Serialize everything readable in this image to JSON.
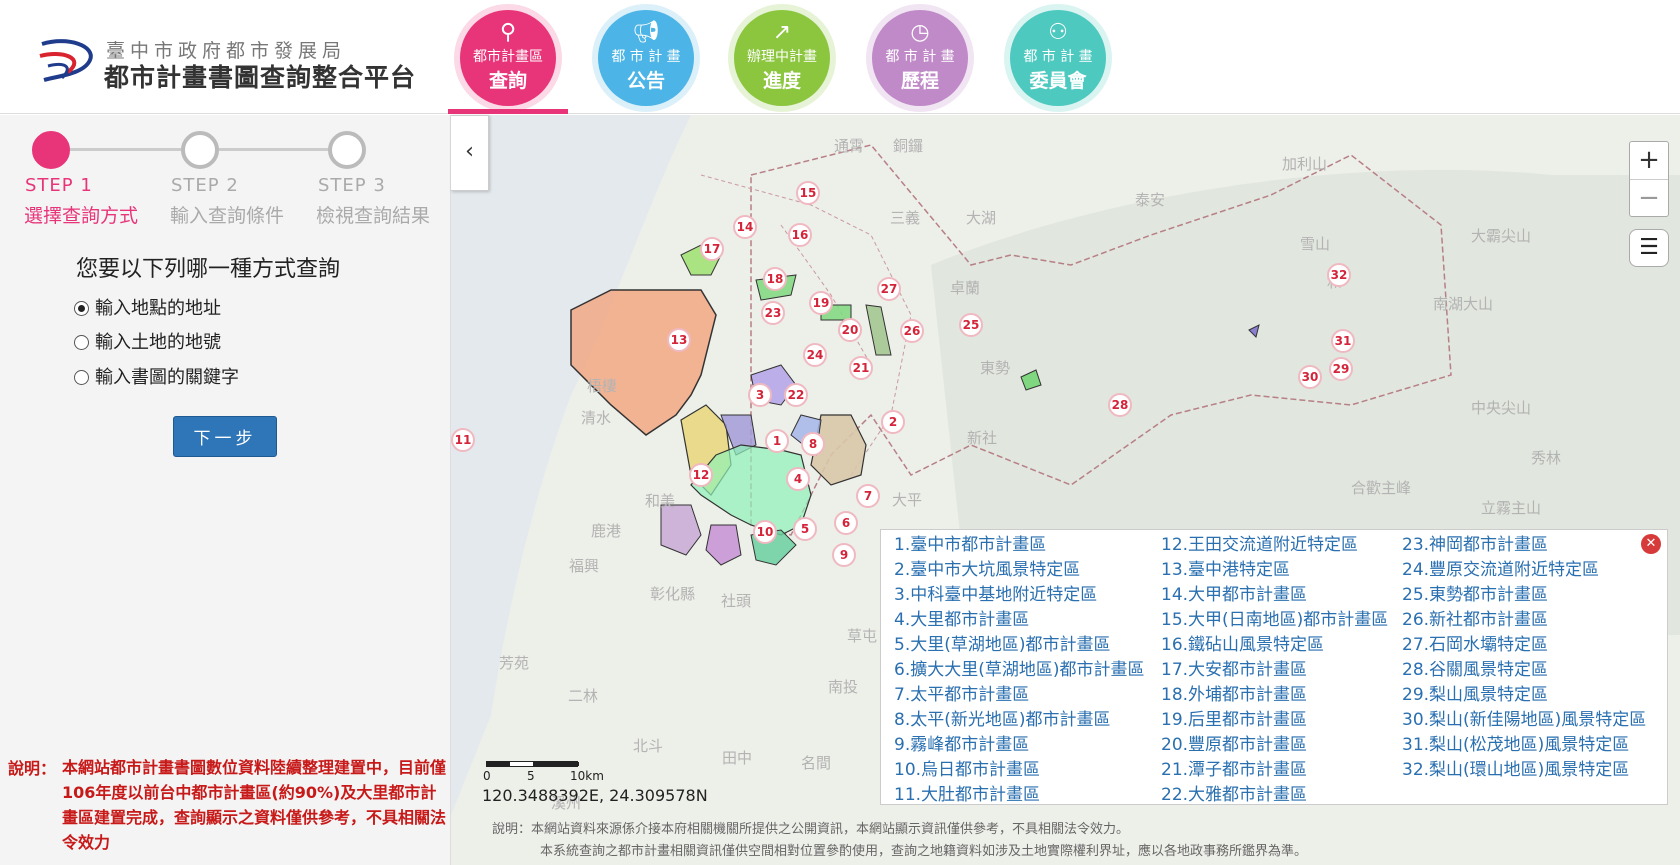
{
  "header": {
    "org": "臺中市政府都市發展局",
    "title": "都市計畫書圖查詢整合平台",
    "nav": [
      {
        "line1": "都市計畫區",
        "line2": "查詢",
        "icon": "search-icon",
        "color": "#e8357a",
        "halo": "#fbd9e6"
      },
      {
        "line1": "都 市 計 畫",
        "line2": "公告",
        "icon": "megaphone-icon",
        "color": "#4cb4e6",
        "halo": "#dcf0fa"
      },
      {
        "line1": "辦理中計畫",
        "line2": "進度",
        "icon": "trend-up-icon",
        "color": "#8cc63f",
        "halo": "#e7f3d6"
      },
      {
        "line1": "都 市 計 畫",
        "line2": "歷程",
        "icon": "clock-icon",
        "color": "#c08ac8",
        "halo": "#f1e4f3"
      },
      {
        "line1": "都 市 計 畫",
        "line2": "委員會",
        "icon": "users-icon",
        "color": "#4ec9c0",
        "halo": "#daf4f1"
      }
    ]
  },
  "sidebar": {
    "steps": [
      {
        "name": "STEP 1",
        "desc": "選擇查詢方式"
      },
      {
        "name": "STEP 2",
        "desc": "輸入查詢條件"
      },
      {
        "name": "STEP 3",
        "desc": "檢視查詢結果"
      }
    ],
    "question": "您要以下列哪一種方式查詢",
    "options": [
      "輸入地點的地址",
      "輸入土地的地號",
      "輸入書圖的關鍵字"
    ],
    "next_label": "下一步",
    "notice_label": "說明：",
    "notice_text": "本網站都市計畫書圖數位資料陸續整理建置中，目前僅106年度以前台中都市計畫區(約90%)及大里都市計畫區建置完成，查詢顯示之資料僅供參考，不具相關法令效力"
  },
  "map": {
    "places": [
      "通霄",
      "銅鑼",
      "泰安",
      "加利山",
      "三義",
      "大湖",
      "卓蘭",
      "和",
      "雪山",
      "大霸尖山",
      "南湖大山",
      "中央尖山",
      "東勢",
      "新社",
      "合歡主峰",
      "秀林",
      "立霧主山",
      "清水",
      "梧棲",
      "和美",
      "鹿港",
      "大平",
      "芳苑",
      "二林",
      "社頭",
      "草屯",
      "南投",
      "名間",
      "田中",
      "北斗",
      "彰化縣",
      "福興",
      "溪州"
    ],
    "scale_labels": [
      "0",
      "5",
      "10km"
    ],
    "coords": "120.3488392E, 24.309578N",
    "note1": "說明：本網站資料來源係介接本府相關機關所提供之公開資訊，本網站顯示資訊僅供參考，不具相關法令效力。",
    "note2": "本系統查詢之都市計畫相關資訊僅供空間相對位置參酌使用，查詢之地籍資料如涉及土地實際權利界址，應以各地政事務所鑑界為準。",
    "markers": [
      "1",
      "2",
      "3",
      "4",
      "5",
      "6",
      "7",
      "8",
      "9",
      "10",
      "11",
      "12",
      "13",
      "14",
      "15",
      "16",
      "17",
      "18",
      "19",
      "20",
      "21",
      "22",
      "23",
      "24",
      "25",
      "26",
      "27",
      "28",
      "29",
      "30",
      "31",
      "32"
    ]
  },
  "legend": {
    "col1": [
      "1.臺中市都市計畫區",
      "2.臺中市大坑風景特定區",
      "3.中科臺中基地附近特定區",
      "4.大里都市計畫區",
      "5.大里(草湖地區)都市計畫區",
      "6.擴大大里(草湖地區)都市計畫區",
      "7.太平都市計畫區",
      "8.太平(新光地區)都市計畫區",
      "9.霧峰都市計畫區",
      "10.烏日都市計畫區",
      "11.大肚都市計畫區"
    ],
    "col2": [
      "12.王田交流道附近特定區",
      "13.臺中港特定區",
      "14.大甲都市計畫區",
      "15.大甲(日南地區)都市計畫區",
      "16.鐵砧山風景特定區",
      "17.大安都市計畫區",
      "18.外埔都市計畫區",
      "19.后里都市計畫區",
      "20.豐原都市計畫區",
      "21.潭子都市計畫區",
      "22.大雅都市計畫區"
    ],
    "col3": [
      "23.神岡都市計畫區",
      "24.豐原交流道附近特定區",
      "25.東勢都市計畫區",
      "26.新社都市計畫區",
      "27.石岡水壩特定區",
      "28.谷關風景特定區",
      "29.梨山風景特定區",
      "30.梨山(新佳陽地區)風景特定區",
      "31.梨山(松茂地區)風景特定區",
      "32.梨山(環山地區)風景特定區"
    ],
    "close_label": "✕"
  }
}
